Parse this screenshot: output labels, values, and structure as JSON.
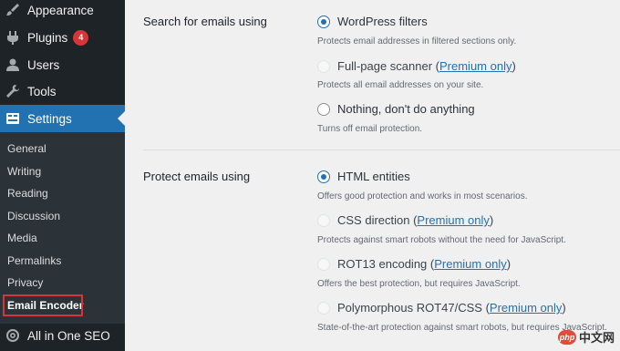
{
  "sidebar": {
    "items": [
      {
        "label": "Appearance",
        "icon": "paintbrush-icon"
      },
      {
        "label": "Plugins",
        "icon": "plugin-icon",
        "badge": "4"
      },
      {
        "label": "Users",
        "icon": "user-icon"
      },
      {
        "label": "Tools",
        "icon": "wrench-icon"
      },
      {
        "label": "Settings",
        "icon": "settings-icon"
      }
    ],
    "submenu": [
      "General",
      "Writing",
      "Reading",
      "Discussion",
      "Media",
      "Permalinks",
      "Privacy",
      "Email Encoder"
    ],
    "bottom_item": {
      "label": "All in One SEO",
      "icon": "gear-icon"
    }
  },
  "settings": {
    "search_group": {
      "label": "Search for emails using",
      "options": [
        {
          "label": "WordPress filters",
          "desc": "Protects email addresses in filtered sections only.",
          "checked": true
        },
        {
          "label": "Full-page scanner (",
          "link": "Premium only",
          "suffix": ")",
          "desc": "Protects all email addresses on your site."
        },
        {
          "label": "Nothing, don't do anything",
          "desc": "Turns off email protection."
        }
      ]
    },
    "protect_group": {
      "label": "Protect emails using",
      "options": [
        {
          "label": "HTML entities",
          "desc": "Offers good protection and works in most scenarios.",
          "checked": true
        },
        {
          "label": "CSS direction (",
          "link": "Premium only",
          "suffix": ")",
          "desc": "Protects against smart robots without the need for JavaScript."
        },
        {
          "label": "ROT13 encoding (",
          "link": "Premium only",
          "suffix": ")",
          "desc": "Offers the best protection, but requires JavaScript."
        },
        {
          "label": "Polymorphous ROT47/CSS (",
          "link": "Premium only",
          "suffix": ")",
          "desc": "State-of-the-art protection against smart robots, but requires JavaScript."
        }
      ]
    }
  },
  "watermark": {
    "logo": "php",
    "text": "中文网"
  },
  "colors": {
    "sidebar_bg": "#1d2327",
    "active": "#2271b1",
    "badge": "#d63638",
    "link": "#2271b1"
  }
}
